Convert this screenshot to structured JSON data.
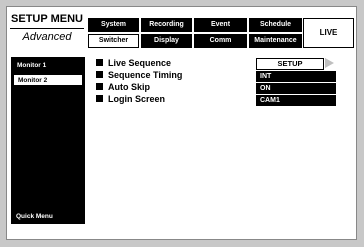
{
  "title": {
    "line1": "SETUP MENU",
    "line2": "Advanced"
  },
  "tabs_top": [
    {
      "label": "System"
    },
    {
      "label": "Recording"
    },
    {
      "label": "Event"
    },
    {
      "label": "Schedule"
    }
  ],
  "tabs_bottom": [
    {
      "label": "Switcher"
    },
    {
      "label": "Display"
    },
    {
      "label": "Comm"
    },
    {
      "label": "Maintenance"
    }
  ],
  "live_button": "LIVE",
  "sidebar": {
    "items": [
      {
        "label": "Monitor 1"
      },
      {
        "label": "Monitor 2"
      }
    ],
    "quick_menu": "Quick Menu"
  },
  "settings": [
    {
      "label": "Live Sequence",
      "value": "SETUP"
    },
    {
      "label": "Sequence Timing",
      "value": "INT"
    },
    {
      "label": "Auto Skip",
      "value": "ON"
    },
    {
      "label": "Login Screen",
      "value": "CAM1"
    }
  ],
  "colors": {
    "background": "#c8c8c8",
    "panel": "#ffffff",
    "dark": "#000000",
    "arrow": "#bfbfbf"
  }
}
